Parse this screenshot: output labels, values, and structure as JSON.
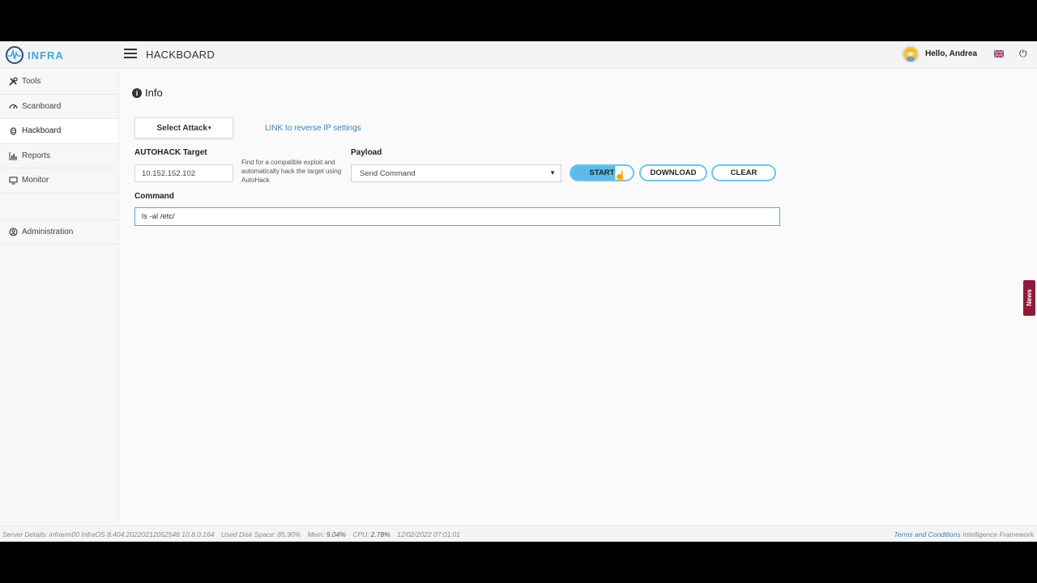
{
  "header": {
    "logo_text": "INFRA",
    "title": "HACKBOARD",
    "greeting": "Hello, Andrea",
    "power_icon": "power-icon",
    "flag_icon": "uk-flag-icon"
  },
  "sidebar": {
    "items": [
      {
        "label": "Tools",
        "icon": "tools-icon"
      },
      {
        "label": "Scanboard",
        "icon": "dashboard-icon"
      },
      {
        "label": "Hackboard",
        "icon": "bug-icon"
      },
      {
        "label": "Reports",
        "icon": "bar-chart-icon"
      },
      {
        "label": "Monitor",
        "icon": "monitor-icon"
      }
    ],
    "admin_label": "Administration"
  },
  "main": {
    "info_title": "Info",
    "select_attack_label": "Select Attack",
    "reverse_link": "LINK to reverse IP settings",
    "autohack_label": "AUTOHACK Target",
    "target_value": "10.152.152.102",
    "autohack_help": "Find for a compatible exploit and automatically hack the target using AutoHack",
    "payload_label": "Payload",
    "payload_selected": "Send Command",
    "start_label": "START",
    "download_label": "DOWNLOAD",
    "clear_label": "CLEAR",
    "command_label": "Command",
    "command_value": "ls -al /etc/"
  },
  "news_tab": "News",
  "footer": {
    "server_label": "Server Details:",
    "server_value": "infravm00 InfraOS 8.404.20220212052546 10.8.0.164",
    "disk_label": "Used Disk Space:",
    "disk_value": "85.90%",
    "mem_label": "Mem:",
    "mem_value": "9.04%",
    "cpu_label": "CPU:",
    "cpu_value": "2.78%",
    "timestamp": "12/02/2022 07:01:01",
    "terms_link": "Terms and Conditions",
    "framework": "Intelligence Framework"
  },
  "colors": {
    "accent": "#5bbce9",
    "link": "#3a84b8",
    "news": "#8e1b3a"
  }
}
